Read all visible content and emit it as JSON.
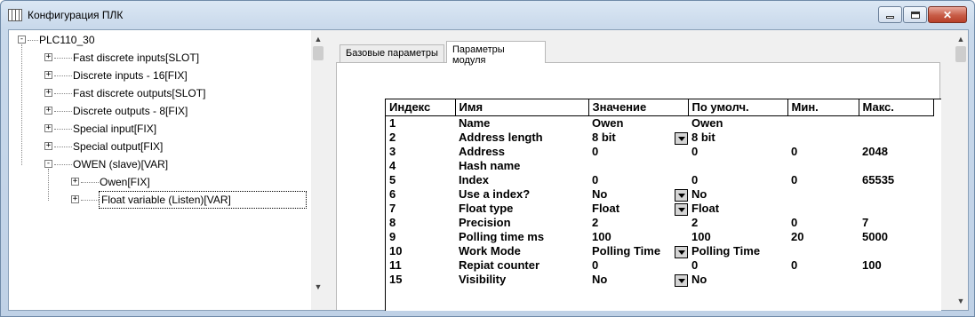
{
  "window": {
    "title": "Конфигурация ПЛК"
  },
  "tree": {
    "root": "PLC110_30",
    "items": [
      {
        "label": "Fast discrete inputs[SLOT]",
        "level": 1,
        "state": "+"
      },
      {
        "label": "Discrete inputs - 16[FIX]",
        "level": 1,
        "state": "+"
      },
      {
        "label": "Fast discrete outputs[SLOT]",
        "level": 1,
        "state": "+"
      },
      {
        "label": "Discrete outputs - 8[FIX]",
        "level": 1,
        "state": "+"
      },
      {
        "label": "Special input[FIX]",
        "level": 1,
        "state": "+"
      },
      {
        "label": "Special output[FIX]",
        "level": 1,
        "state": "+"
      },
      {
        "label": "OWEN (slave)[VAR]",
        "level": 1,
        "state": "-"
      },
      {
        "label": "Owen[FIX]",
        "level": 2,
        "state": "+"
      },
      {
        "label": "Float variable (Listen)[VAR]",
        "level": 2,
        "state": "+",
        "selected": true
      }
    ],
    "root_state": "-"
  },
  "tabs": [
    {
      "label": "Базовые параметры",
      "active": false
    },
    {
      "label": "Параметры модуля",
      "active": true
    }
  ],
  "table": {
    "headers": [
      "Индекс",
      "Имя",
      "Значение",
      "По умолч.",
      "Мин.",
      "Макс."
    ],
    "rows": [
      {
        "index": "1",
        "name": "Name",
        "value": "Owen",
        "dropdown": false,
        "default": "Owen",
        "min": "",
        "max": ""
      },
      {
        "index": "2",
        "name": "Address length",
        "value": "8 bit",
        "dropdown": true,
        "default": "8 bit",
        "min": "",
        "max": ""
      },
      {
        "index": "3",
        "name": "Address",
        "value": "0",
        "dropdown": false,
        "default": "0",
        "min": "0",
        "max": "2048"
      },
      {
        "index": "4",
        "name": "Hash name",
        "value": "",
        "dropdown": false,
        "default": "",
        "min": "",
        "max": ""
      },
      {
        "index": "5",
        "name": "Index",
        "value": "0",
        "dropdown": false,
        "default": "0",
        "min": "0",
        "max": "65535"
      },
      {
        "index": "6",
        "name": "Use a index?",
        "value": "No",
        "dropdown": true,
        "default": "No",
        "min": "",
        "max": ""
      },
      {
        "index": "7",
        "name": "Float type",
        "value": "Float",
        "dropdown": true,
        "default": "Float",
        "min": "",
        "max": ""
      },
      {
        "index": "8",
        "name": "Precision",
        "value": "2",
        "dropdown": false,
        "default": "2",
        "min": "0",
        "max": "7"
      },
      {
        "index": "9",
        "name": "Polling time ms",
        "value": "100",
        "dropdown": false,
        "default": "100",
        "min": "20",
        "max": "5000"
      },
      {
        "index": "10",
        "name": "Work Mode",
        "value": "Polling Time",
        "dropdown": true,
        "default": "Polling Time",
        "min": "",
        "max": ""
      },
      {
        "index": "11",
        "name": "Repiat counter",
        "value": "0",
        "dropdown": false,
        "default": "0",
        "min": "0",
        "max": "100"
      },
      {
        "index": "15",
        "name": "Visibility",
        "value": "No",
        "dropdown": true,
        "default": "No",
        "min": "",
        "max": ""
      }
    ]
  }
}
